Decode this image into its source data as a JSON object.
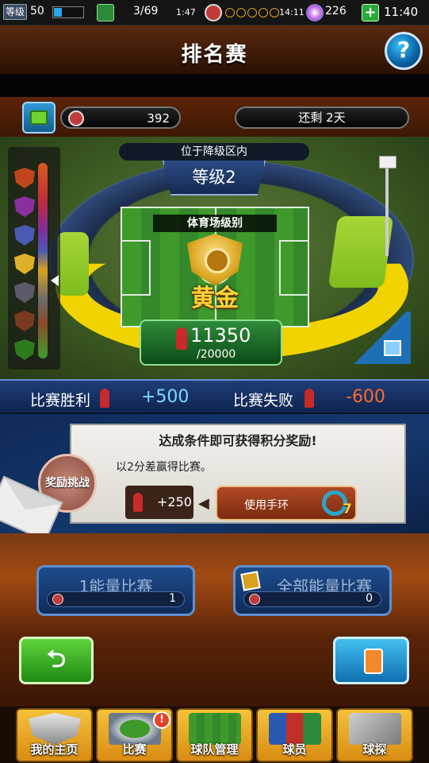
{
  "status_bar": {
    "level_label": "等级",
    "level": "50",
    "matches": "3/69",
    "match_timer": "1:47",
    "energy_timer": "14:11",
    "gems": "226",
    "clock": "11:40"
  },
  "header": {
    "title": "排名赛",
    "help": "?"
  },
  "info_row": {
    "points": "392",
    "time_left": "还剩 2天"
  },
  "stadium": {
    "relegation": "位于降级区内",
    "level": "等级2",
    "stadium_level_label": "体育场级别",
    "tier": "黄金",
    "score": "11350",
    "score_target": "/20000",
    "score_progress": 0.5675
  },
  "results": {
    "win_label": "比赛胜利",
    "win_value": "+500",
    "loss_label": "比赛失败",
    "loss_value": "-600"
  },
  "challenge": {
    "badge": "奖励挑战",
    "heading": "达成条件即可获得积分奖励!",
    "condition": "以2分差赢得比赛。",
    "bonus": "+250",
    "use_button": "使用手环",
    "bracelet_count": "7"
  },
  "matches": {
    "one_energy_label": "1能量比赛",
    "one_energy_count": "1",
    "all_energy_label": "全部能量比赛",
    "all_energy_count": "0"
  },
  "nav": {
    "home": "我的主页",
    "match": "比赛",
    "team": "球队管理",
    "players": "球员",
    "scout": "球探",
    "notice": "!"
  },
  "colors": {
    "brand_brown": "#3a1806",
    "accent_blue": "#1f3d78",
    "win": "#7ad8ff",
    "loss": "#ff6a2a",
    "gold": "#ffd23a"
  }
}
